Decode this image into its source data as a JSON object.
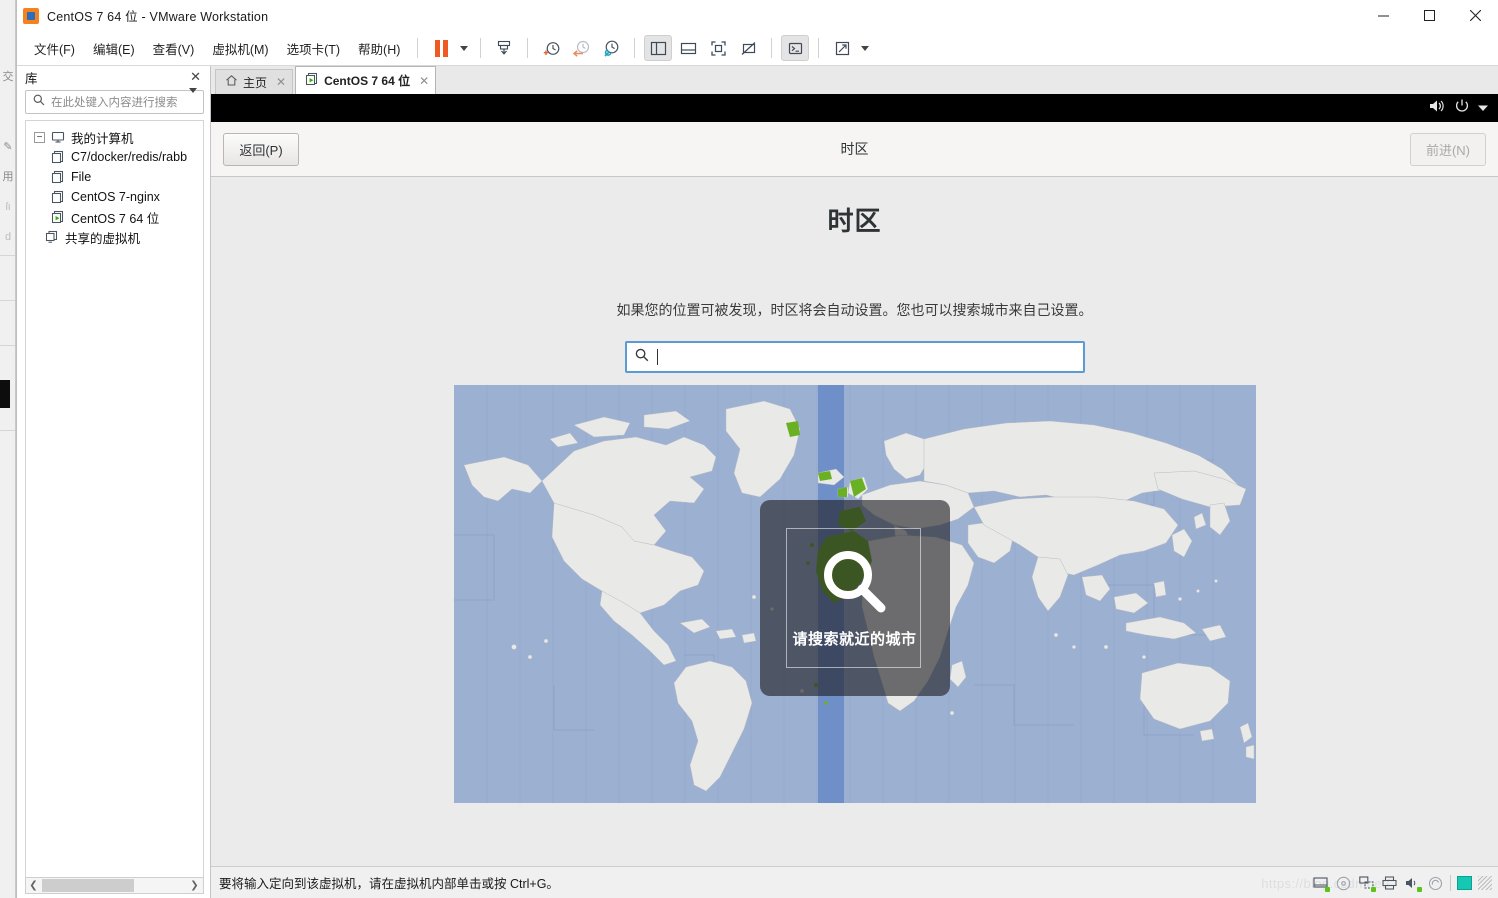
{
  "window": {
    "title": "CentOS 7 64 位 - VMware Workstation",
    "app_icon": "vmware-logo-icon",
    "controls": {
      "minimize": "—",
      "maximize": "☐",
      "close": "✕"
    }
  },
  "menubar": {
    "items": [
      {
        "label": "文件(F)",
        "name": "menu-file"
      },
      {
        "label": "编辑(E)",
        "name": "menu-edit"
      },
      {
        "label": "查看(V)",
        "name": "menu-view"
      },
      {
        "label": "虚拟机(M)",
        "name": "menu-vm"
      },
      {
        "label": "选项卡(T)",
        "name": "menu-tabs"
      },
      {
        "label": "帮助(H)",
        "name": "menu-help"
      }
    ],
    "toolbar": [
      {
        "name": "suspend-button",
        "icon": "pause-icon"
      },
      {
        "name": "power-dropdown",
        "icon": "chevron-down-icon"
      },
      {
        "name": "snapshot-manager-button",
        "icon": "snapshot-icon"
      },
      {
        "name": "take-snapshot-button",
        "icon": "clock-plus-icon"
      },
      {
        "name": "revert-snapshot-button",
        "icon": "clock-back-icon"
      },
      {
        "name": "manage-snapshots-button",
        "icon": "clock-wrench-icon"
      },
      {
        "name": "show-library-button",
        "icon": "panel-left-icon"
      },
      {
        "name": "show-thumbnails-button",
        "icon": "panel-bottom-icon"
      },
      {
        "name": "fullscreen-button",
        "icon": "fullscreen-icon"
      },
      {
        "name": "unity-button",
        "icon": "unity-icon"
      },
      {
        "name": "console-button",
        "icon": "terminal-icon"
      },
      {
        "name": "stretch-button",
        "icon": "expand-arrows-icon"
      },
      {
        "name": "stretch-dropdown",
        "icon": "chevron-down-icon"
      }
    ]
  },
  "sidebar": {
    "title": "库",
    "close_icon": "close-icon",
    "search": {
      "placeholder": "在此处键入内容进行搜索",
      "value": "",
      "icon": "search-icon",
      "dropdown_icon": "chevron-down-icon"
    },
    "tree": [
      {
        "label": "我的计算机",
        "name": "tree-item-my-computer",
        "level": 0,
        "expander": "−",
        "icon": "computer-icon"
      },
      {
        "label": "C7/docker/redis/rabb",
        "name": "tree-item-c7-docker",
        "level": 1,
        "icon": "vm-icon"
      },
      {
        "label": "File",
        "name": "tree-item-file",
        "level": 1,
        "icon": "vm-icon"
      },
      {
        "label": "CentOS 7-nginx",
        "name": "tree-item-centos7-nginx",
        "level": 1,
        "icon": "vm-icon"
      },
      {
        "label": "CentOS 7 64 位",
        "name": "tree-item-centos7-64",
        "level": 1,
        "icon": "vm-running-icon"
      },
      {
        "label": "共享的虚拟机",
        "name": "tree-item-shared-vms",
        "level": 0,
        "icon": "shared-vm-icon"
      }
    ],
    "hscroll": {
      "left_arrow": "❮",
      "right_arrow": "❯"
    }
  },
  "tabs": [
    {
      "label": "主页",
      "name": "tab-home",
      "icon": "home-icon",
      "active": false,
      "close_icon": "✕"
    },
    {
      "label": "CentOS 7 64 位",
      "name": "tab-centos7-64",
      "icon": "vm-running-icon",
      "active": true,
      "close_icon": "✕"
    }
  ],
  "guest": {
    "topbar": {
      "volume_icon": "volume-icon",
      "power_icon": "power-icon",
      "menu_icon": "chevron-down-icon"
    },
    "header": {
      "back_label": "返回(P)",
      "title": "时区",
      "next_label": "前进(N)",
      "next_disabled": true
    },
    "page": {
      "heading": "时区",
      "description": "如果您的位置可被发现，时区将会自动设置。您也可以搜索城市来自己设置。",
      "search": {
        "value": "",
        "placeholder": "",
        "icon": "search-icon"
      },
      "map": {
        "overlay_text": "请搜索就近的城市",
        "overlay_icon": "magnifier-icon",
        "ocean_color": "#9cb0d2",
        "highlight_band_color": "#6f8fc8",
        "land_color": "#e9e9e7",
        "selected_land_color": "#6ab023"
      }
    }
  },
  "statusbar": {
    "message": "要将输入定向到该虚拟机，请在虚拟机内部单击或按 Ctrl+G。",
    "watermark": "https://blog.csdn.net/",
    "icons": [
      {
        "name": "status-harddisk-icon",
        "glyph": "hdd"
      },
      {
        "name": "status-cdrom-icon",
        "glyph": "cd"
      },
      {
        "name": "status-network-icon",
        "glyph": "net"
      },
      {
        "name": "status-printer-icon",
        "glyph": "printer"
      },
      {
        "name": "status-sound-icon",
        "glyph": "sound"
      },
      {
        "name": "status-usb-icon",
        "glyph": "usb"
      }
    ]
  }
}
